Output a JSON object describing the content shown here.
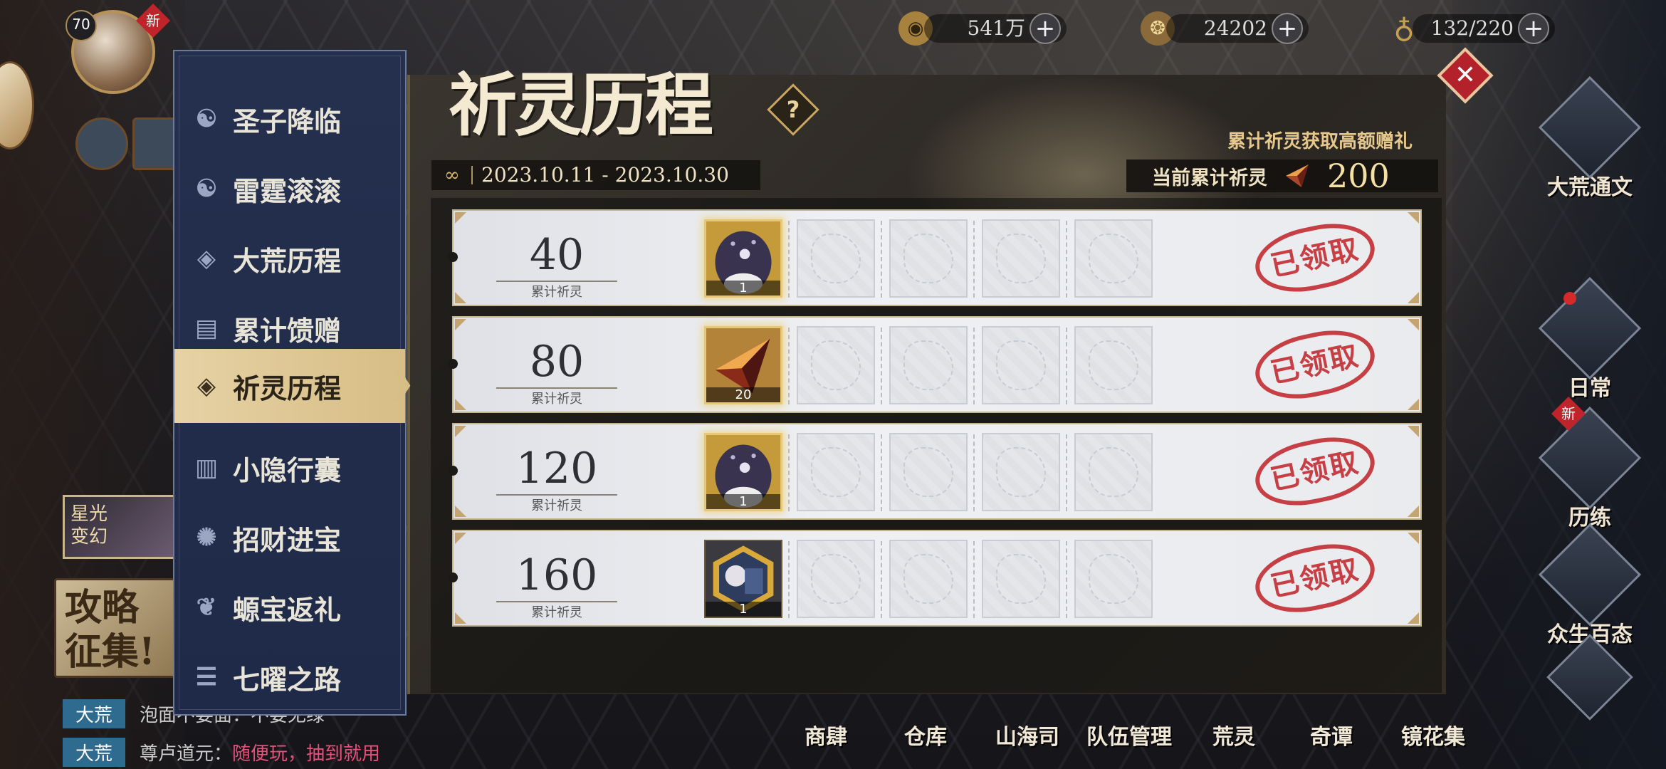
{
  "resources": [
    {
      "name": "coin",
      "icon": "coin-icon",
      "value": "541万"
    },
    {
      "name": "jade",
      "icon": "jade-icon",
      "value": "24202"
    },
    {
      "name": "stamina",
      "icon": "gourd-icon",
      "value": "132/220"
    }
  ],
  "player": {
    "level": "70",
    "new_badge": "新"
  },
  "left_side": {
    "starlight_label": "星光\n变幻",
    "strategy_label": "攻略\n征集!"
  },
  "chat": [
    {
      "tag": "大荒",
      "text": "泡面不要面：不要无绿",
      "highlight": ""
    },
    {
      "tag": "大荒",
      "text": "尊卢道元：",
      "highlight": "随便玩，抽到就用"
    }
  ],
  "menu": {
    "items": [
      {
        "label": "圣子降临",
        "icon": "swirl-icon"
      },
      {
        "label": "雷霆滚滚",
        "icon": "swirl-icon"
      },
      {
        "label": "大荒历程",
        "icon": "diamond-icon"
      },
      {
        "label": "累计馈赠",
        "icon": "chest-icon"
      },
      {
        "label": "祈灵历程",
        "icon": "diamond-icon",
        "active": true
      },
      {
        "label": "小隐行囊",
        "icon": "bag-icon"
      },
      {
        "label": "招财进宝",
        "icon": "flame-icon"
      },
      {
        "label": "螈宝返礼",
        "icon": "salamander-icon"
      },
      {
        "label": "七曜之路",
        "icon": "road-icon"
      }
    ]
  },
  "panel": {
    "title": "祈灵历程",
    "help": "?",
    "date": "2023.10.11 - 2023.10.30",
    "subtitle": "累计祈灵获取高额赠礼",
    "current_label": "当前累计祈灵",
    "current_value": "200"
  },
  "rewards": [
    {
      "count": "40",
      "label": "累计祈灵",
      "item": "ghost-mask-icon",
      "qty": "1",
      "status": "已领取"
    },
    {
      "count": "80",
      "label": "累计祈灵",
      "item": "spirit-crystal-icon",
      "qty": "20",
      "status": "已领取"
    },
    {
      "count": "120",
      "label": "累计祈灵",
      "item": "ghost-mask-icon",
      "qty": "1",
      "status": "已领取"
    },
    {
      "count": "160",
      "label": "累计祈灵",
      "item": "character-card-icon",
      "qty": "1",
      "status": "已领取"
    }
  ],
  "right_nav": [
    {
      "label": "大荒通文",
      "icon": "compass-icon"
    },
    {
      "label": "日常",
      "icon": "eye-icon"
    },
    {
      "label": "历练",
      "icon": "beast-icon",
      "badge": "新"
    },
    {
      "label": "众生百态",
      "icon": "cards-icon"
    }
  ],
  "bottom_nav": [
    "商肆",
    "仓库",
    "山海司",
    "队伍管理",
    "荒灵",
    "奇谭",
    "镜花集"
  ],
  "colors": {
    "accent": "#d7bd86",
    "stamp": "#c2282e",
    "menu_bg": "#25304f"
  }
}
